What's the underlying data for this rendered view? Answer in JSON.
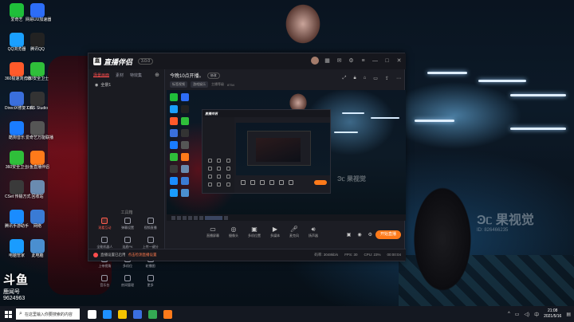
{
  "desktop": {
    "icons": [
      {
        "label": "爱奇艺",
        "icon": "iqiyi-icon",
        "color": "#1fbf3a"
      },
      {
        "label": "网易UU加速器",
        "icon": "uu-icon",
        "color": "#2d6df6"
      },
      {
        "label": "QQ浏览器",
        "icon": "qq-browser-icon",
        "color": "#1aa0ff"
      },
      {
        "label": "腾讯QQ",
        "icon": "qq-icon",
        "color": "#222222"
      },
      {
        "label": "360极速浏览器",
        "icon": "360-browser-icon",
        "color": "#ff5a2a"
      },
      {
        "label": "360安全卫士",
        "icon": "360-security-icon",
        "color": "#2fbf3a"
      },
      {
        "label": "DirectX修复工具",
        "icon": "directx-icon",
        "color": "#3a6fdc"
      },
      {
        "label": "OBS Studio",
        "icon": "obs-icon",
        "color": "#333333"
      },
      {
        "label": "酷狗音乐",
        "icon": "kugou-icon",
        "color": "#1a7cff"
      },
      {
        "label": "爱奇艺万能联播",
        "icon": "video-icon",
        "color": "#555555"
      },
      {
        "label": "360安全卫士",
        "icon": "360-guard-icon",
        "color": "#2fbf3a"
      },
      {
        "label": "斗鱼直播伴侣",
        "icon": "douyu-icon",
        "color": "#ff7a1a"
      },
      {
        "label": "CSet 传输方式",
        "icon": "cset-icon",
        "color": "#3a3a3a"
      },
      {
        "label": "回收站",
        "icon": "recycle-bin-icon",
        "color": "#6a8bb0"
      },
      {
        "label": "腾讯手游助手",
        "icon": "tencent-game-icon",
        "color": "#1a8cff"
      },
      {
        "label": "网络",
        "icon": "network-icon",
        "color": "#3a7bd5"
      },
      {
        "label": "电脑管家",
        "icon": "pc-manager-icon",
        "color": "#1a9cff"
      },
      {
        "label": "此电脑",
        "icon": "this-pc-icon",
        "color": "#4a8fd0"
      }
    ],
    "overlay_big": "斗鱼",
    "overlay_small": "鹿闻号",
    "overlay_num": "9624963",
    "watermark_main": "Ͽᥴ 果视觉",
    "watermark_sub": "ID: 826466235"
  },
  "app": {
    "logo_text": "直播伴侣",
    "version": "3.0.0",
    "left_tabs": [
      "场景画面",
      "素材",
      "特效集"
    ],
    "scene_name": "全景1",
    "tools_label": "工具箱",
    "tools": [
      {
        "label": "观看互动",
        "icon": "interact-icon",
        "highlight": true
      },
      {
        "label": "弹幕设置",
        "icon": "barrage-icon",
        "highlight": false
      },
      {
        "label": "视频直播",
        "icon": "video-live-icon",
        "highlight": false
      },
      {
        "label": "全能机器人",
        "icon": "robot-icon",
        "highlight": false
      },
      {
        "label": "连麦PK",
        "icon": "pk-icon",
        "highlight": false
      },
      {
        "label": "上传一键分",
        "icon": "upload-icon",
        "highlight": false
      },
      {
        "label": "上帝视角",
        "icon": "god-view-icon",
        "highlight": false
      },
      {
        "label": "多机位",
        "icon": "multi-cam-icon",
        "highlight": false
      },
      {
        "label": "轮播图",
        "icon": "carousel-icon",
        "highlight": false
      },
      {
        "label": "音乐台",
        "icon": "music-icon",
        "highlight": false
      },
      {
        "label": "房间管理",
        "icon": "room-icon",
        "highlight": false
      },
      {
        "label": "更多",
        "icon": "more-icon",
        "highlight": false
      }
    ],
    "stream_title": "今晚10点开播。",
    "edit_pill": "修改",
    "stream_chips": [
      "标签视频",
      "游戏娱乐"
    ],
    "stream_meta": [
      "主播等级",
      "8754"
    ],
    "controls": [
      {
        "label": "直播屏幕",
        "icon": "screen-icon"
      },
      {
        "label": "摄像头",
        "icon": "camera-icon"
      },
      {
        "label": "多机位置",
        "icon": "multi-position-icon"
      },
      {
        "label": "多媒体",
        "icon": "media-icon"
      },
      {
        "label": "麦克风",
        "icon": "mic-icon"
      },
      {
        "label": "扬声器",
        "icon": "speaker-icon"
      }
    ],
    "live_button": "开始直播",
    "status_warning": "直播设置已启用",
    "status_link": "点击检测直播设置",
    "status_right": [
      "码率: 3048kb/s",
      "FPS: 30",
      "CPU: 23%",
      "00:00:04"
    ]
  },
  "taskbar": {
    "search_placeholder": "在这里输入你要搜索的内容",
    "apps": [
      {
        "icon": "task-view-icon",
        "color": "#ffffff"
      },
      {
        "icon": "edge-icon",
        "color": "#1e90ff"
      },
      {
        "icon": "file-explorer-icon",
        "color": "#f5c400"
      },
      {
        "icon": "store-icon",
        "color": "#3b6fe0"
      },
      {
        "icon": "chrome-icon",
        "color": "#34a853"
      },
      {
        "icon": "douyu-task-icon",
        "color": "#ff7a1a"
      }
    ],
    "time": "21:08",
    "date": "2021/5/16"
  }
}
